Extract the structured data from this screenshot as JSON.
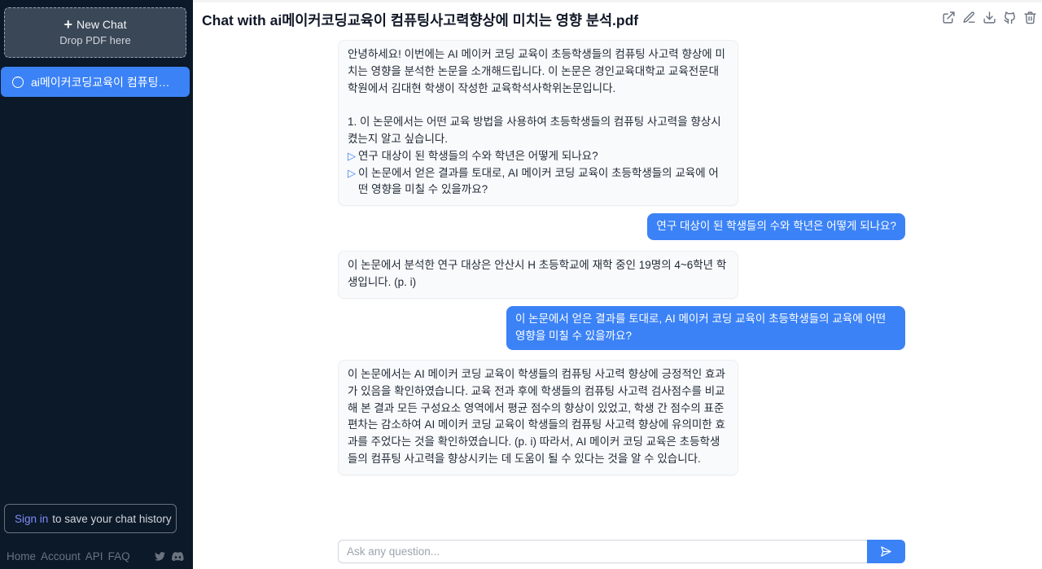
{
  "sidebar": {
    "new_chat_label": "New Chat",
    "drop_label": "Drop PDF here",
    "chats": [
      {
        "label": "ai메이커코딩교육이 컴퓨팅사고력향상에 미치는 영향 분석.pdf"
      }
    ],
    "signin_link": "Sign in",
    "signin_text": "to save your chat history",
    "footer_links": [
      "Home",
      "Account",
      "API",
      "FAQ"
    ],
    "social_icons": [
      "twitter-icon",
      "discord-icon"
    ]
  },
  "header": {
    "title": "Chat with ai메이커코딩교육이 컴퓨팅사고력향상에 미치는 영향 분석.pdf",
    "tools": [
      "share-icon",
      "edit-icon",
      "download-icon",
      "github-icon",
      "trash-icon"
    ]
  },
  "messages": {
    "m1": {
      "intro": "안녕하세요! 이번에는 AI 메이커 코딩 교육이 초등학생들의 컴퓨팅 사고력 향상에 미치는 영향을 분석한 논문을 소개해드립니다. 이 논문은 경인교육대학교 교육전문대학원에서 김대현 학생이 작성한 교육학석사학위논문입니다.",
      "question": "1. 이 논문에서는 어떤 교육 방법을 사용하여 초등학생들의 컴퓨팅 사고력을 향상시켰는지 알고 싶습니다.",
      "suggestion1": "연구 대상이 된 학생들의 수와 학년은 어떻게 되나요?",
      "suggestion2": "이 논문에서 얻은 결과를 토대로, AI 메이커 코딩 교육이 초등학생들의 교육에 어떤 영향을 미칠 수 있을까요?"
    },
    "m2": "연구 대상이 된 학생들의 수와 학년은 어떻게 되나요?",
    "m3": "이 논문에서 분석한 연구 대상은 안산시 H 초등학교에 재학 중인 19명의 4~6학년 학생입니다. (p. i)",
    "m4": "이 논문에서 얻은 결과를 토대로, AI 메이커 코딩 교육이 초등학생들의 교육에 어떤 영향을 미칠 수 있을까요?",
    "m5": "이 논문에서는 AI 메이커 코딩 교육이 학생들의 컴퓨팅 사고력 향상에 긍정적인 효과가 있음을 확인하였습니다. 교육 전과 후에 학생들의 컴퓨팅 사고력 검사점수를 비교해 본 결과 모든 구성요소 영역에서 평균 점수의 향상이 있었고, 학생 간 점수의 표준편차는 감소하여 AI 메이커 코딩 교육이 학생들의 컴퓨팅 사고력 향상에 유의미한 효과를 주었다는 것을 확인하였습니다. (p. i) 따라서, AI 메이커 코딩 교육은 초등학생들의 컴퓨팅 사고력을 향상시키는 데 도움이 될 수 있다는 것을 알 수 있습니다."
  },
  "input": {
    "placeholder": "Ask any question..."
  },
  "colors": {
    "sidebar_bg": "#0b1929",
    "accent": "#3b82f6",
    "signin_link": "#818cf8"
  }
}
